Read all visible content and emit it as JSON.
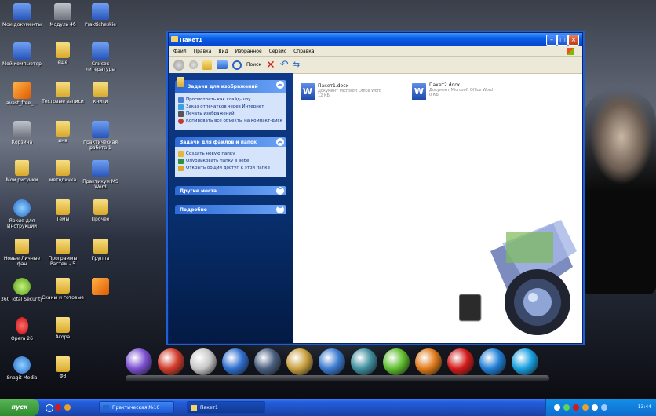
{
  "desktop": {
    "icons": [
      {
        "label": "Мои документы",
        "kind": "doc"
      },
      {
        "label": "Модуль 4б",
        "kind": "gray"
      },
      {
        "label": "Prakticheskie",
        "kind": "doc"
      },
      {
        "label": "Мой компьютер",
        "kind": "doc"
      },
      {
        "label": "ещё",
        "kind": "folder"
      },
      {
        "label": "Список литературы",
        "kind": "doc"
      },
      {
        "label": "avast_free_...",
        "kind": "orange"
      },
      {
        "label": "Тестовые записи",
        "kind": "folder"
      },
      {
        "label": "книги",
        "kind": "folder"
      },
      {
        "label": "Корзина",
        "kind": "gray"
      },
      {
        "label": "ина",
        "kind": "folder"
      },
      {
        "label": "практическая работа 1",
        "kind": "doc"
      },
      {
        "label": "Мои рисунки",
        "kind": "folder"
      },
      {
        "label": "методичка",
        "kind": "folder"
      },
      {
        "label": "Практикум MS Word",
        "kind": "doc"
      },
      {
        "label": "Яркие для Инструкции",
        "kind": "blue"
      },
      {
        "label": "Темы",
        "kind": "folder"
      },
      {
        "label": "Прочее",
        "kind": "folder"
      },
      {
        "label": "Новые Личные фан",
        "kind": "folder"
      },
      {
        "label": "Программы Растем - 5",
        "kind": "folder"
      },
      {
        "label": "Группа",
        "kind": "folder"
      },
      {
        "label": "360 Total Security",
        "kind": "green"
      },
      {
        "label": "Сканы и готовые",
        "kind": "folder"
      },
      {
        "label": "",
        "kind": "orange"
      },
      {
        "label": "Opera 26",
        "kind": "red"
      },
      {
        "label": "Агора",
        "kind": "folder"
      },
      {
        "label": "Snagit Media",
        "kind": "blue"
      },
      {
        "label": "ФЗ",
        "kind": "folder"
      }
    ]
  },
  "window": {
    "title": "Пакет1",
    "menu": [
      "Файл",
      "Правка",
      "Вид",
      "Избранное",
      "Сервис",
      "Справка"
    ],
    "toolbar": {
      "search_label": "Поиск"
    },
    "task_groups": [
      {
        "title": "Задачи для изображений",
        "tasks": [
          {
            "label": "Просмотреть как слайд-шоу",
            "color": "#4b7fd6"
          },
          {
            "label": "Заказ отпечатков через Интернет",
            "color": "#3aa0e0"
          },
          {
            "label": "Печать изображений",
            "color": "#555555"
          },
          {
            "label": "Копировать все объекты на компакт-диск",
            "color": "#c0392b"
          }
        ]
      },
      {
        "title": "Задачи для файлов и папок",
        "tasks": [
          {
            "label": "Создать новую папку",
            "color": "#e8b53a"
          },
          {
            "label": "Опубликовать папку в вебе",
            "color": "#2f8f3a"
          },
          {
            "label": "Открыть общий доступ к этой папке",
            "color": "#d9a928"
          }
        ]
      },
      {
        "title": "Другие места",
        "tasks": []
      },
      {
        "title": "Подробно",
        "tasks": []
      }
    ],
    "files": [
      {
        "name": "Пакет1.docx",
        "desc": "Документ Microsoft Office Word",
        "size": "12 КБ"
      },
      {
        "name": "Пакет2.docx",
        "desc": "Документ Microsoft Office Word",
        "size": "0 КБ"
      }
    ]
  },
  "taskbar": {
    "start_label": "пуск",
    "buttons": [
      "Практическая №16",
      "Пакет1"
    ],
    "clock": "13:44"
  },
  "dock": {
    "icons": [
      "ghost-icon",
      "mario-icon",
      "disc-icon",
      "columns-icon",
      "bars-icon",
      "moon-icon",
      "globe-icon",
      "bag-icon",
      "icq-icon",
      "firefox-icon",
      "opera-icon",
      "ie-icon",
      "skype-icon"
    ]
  }
}
